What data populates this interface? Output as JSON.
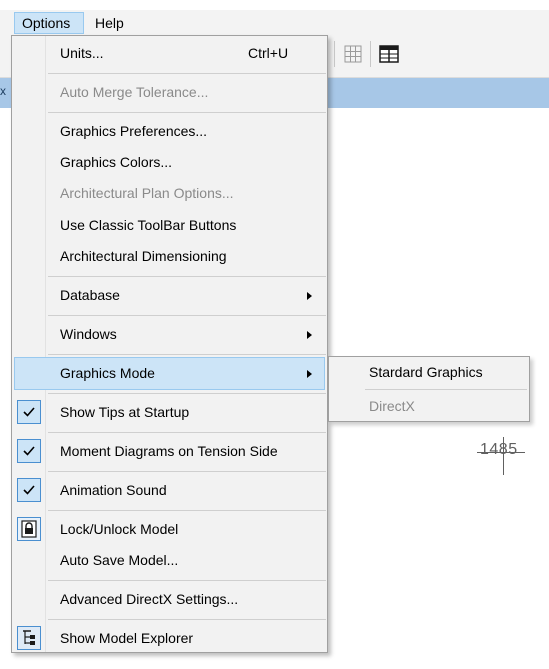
{
  "menubar": {
    "options_label": "Options",
    "help_label": "Help"
  },
  "canvas": {
    "dimension_label": "1485",
    "title_glyph": "x"
  },
  "options_menu": {
    "items": [
      {
        "label": "Units...",
        "shortcut": "Ctrl+U",
        "enabled": true
      },
      {
        "label": "Auto Merge Tolerance...",
        "enabled": false
      },
      {
        "label": "Graphics Preferences...",
        "enabled": true
      },
      {
        "label": "Graphics Colors...",
        "enabled": true
      },
      {
        "label": "Architectural Plan Options...",
        "enabled": false
      },
      {
        "label": "Use Classic ToolBar Buttons",
        "enabled": true
      },
      {
        "label": "Architectural Dimensioning",
        "enabled": true
      },
      {
        "label": "Database",
        "submenu": true,
        "enabled": true
      },
      {
        "label": "Windows",
        "submenu": true,
        "enabled": true
      },
      {
        "label": "Graphics Mode",
        "submenu": true,
        "highlighted": true,
        "enabled": true
      },
      {
        "label": "Show Tips at Startup",
        "checked": true,
        "enabled": true
      },
      {
        "label": "Moment Diagrams on Tension Side",
        "checked": true,
        "enabled": true
      },
      {
        "label": "Animation Sound",
        "checked": true,
        "enabled": true
      },
      {
        "label": "Lock/Unlock Model",
        "icon": "lock-icon",
        "enabled": true
      },
      {
        "label": "Auto Save Model...",
        "enabled": true
      },
      {
        "label": "Advanced DirectX Settings...",
        "enabled": true
      },
      {
        "label": "Show Model Explorer",
        "icon": "tree-icon",
        "enabled": true
      }
    ]
  },
  "graphics_mode_submenu": {
    "items": [
      {
        "label": "Stardard Graphics",
        "enabled": true
      },
      {
        "label": "DirectX",
        "enabled": false
      }
    ]
  },
  "colors": {
    "highlight": "#cce4f7",
    "highlight_border": "#99c9ef",
    "menu_bg": "#f2f2f2",
    "disabled_text": "#8a8a8a",
    "title_bar": "#a7c7e7"
  }
}
